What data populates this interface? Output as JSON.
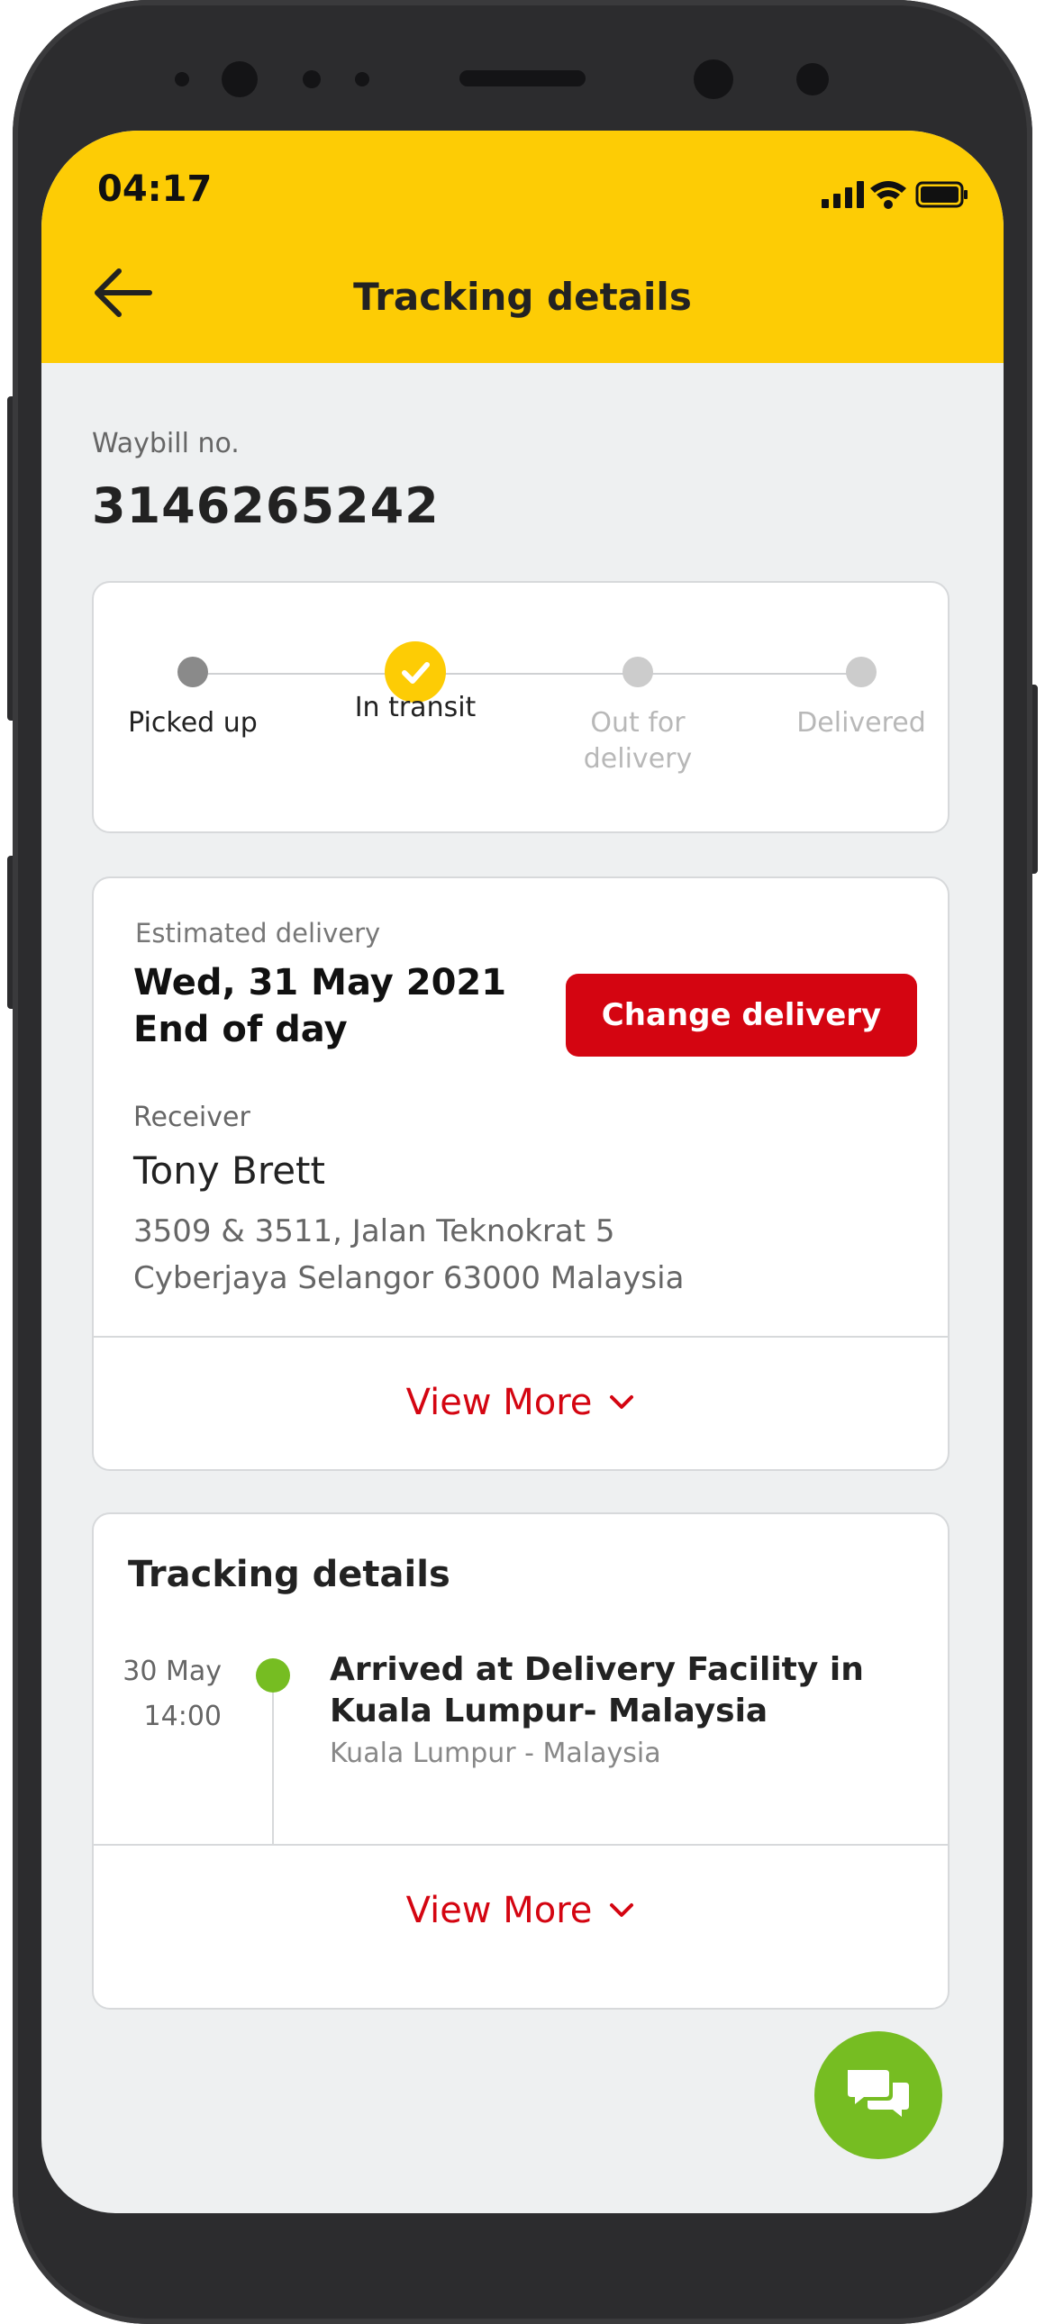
{
  "status_bar": {
    "time": "04:17"
  },
  "header": {
    "title": "Tracking details"
  },
  "waybill": {
    "label": "Waybill no.",
    "number": "3146265242"
  },
  "progress": {
    "steps": [
      {
        "label": "Picked up",
        "state": "done"
      },
      {
        "label": "In transit",
        "state": "current"
      },
      {
        "label": "Out for delivery",
        "state": "pending"
      },
      {
        "label": "Delivered",
        "state": "pending"
      }
    ]
  },
  "delivery": {
    "estimated_label": "Estimated delivery",
    "date": "Wed, 31 May 2021",
    "time": "End of day",
    "change_button": "Change delivery",
    "receiver_label": "Receiver",
    "receiver_name": "Tony Brett",
    "address_line1": "3509 & 3511, Jalan Teknokrat 5",
    "address_line2": "Cyberjaya Selangor 63000 Malaysia",
    "view_more": "View More"
  },
  "tracking": {
    "title": "Tracking details",
    "events": [
      {
        "date": "30 May",
        "time": "14:00",
        "title": "Arrived at Delivery Facility in Kuala Lumpur- Malaysia",
        "location": "Kuala Lumpur - Malaysia"
      }
    ],
    "view_more": "View More"
  },
  "colors": {
    "brand_yellow": "#fdcc05",
    "brand_red": "#d40511",
    "success_green": "#76bd22"
  },
  "icons": {
    "back": "arrow-left-icon",
    "chevron": "chevron-down-icon",
    "chat": "chat-bubbles-icon",
    "check": "check-icon"
  }
}
